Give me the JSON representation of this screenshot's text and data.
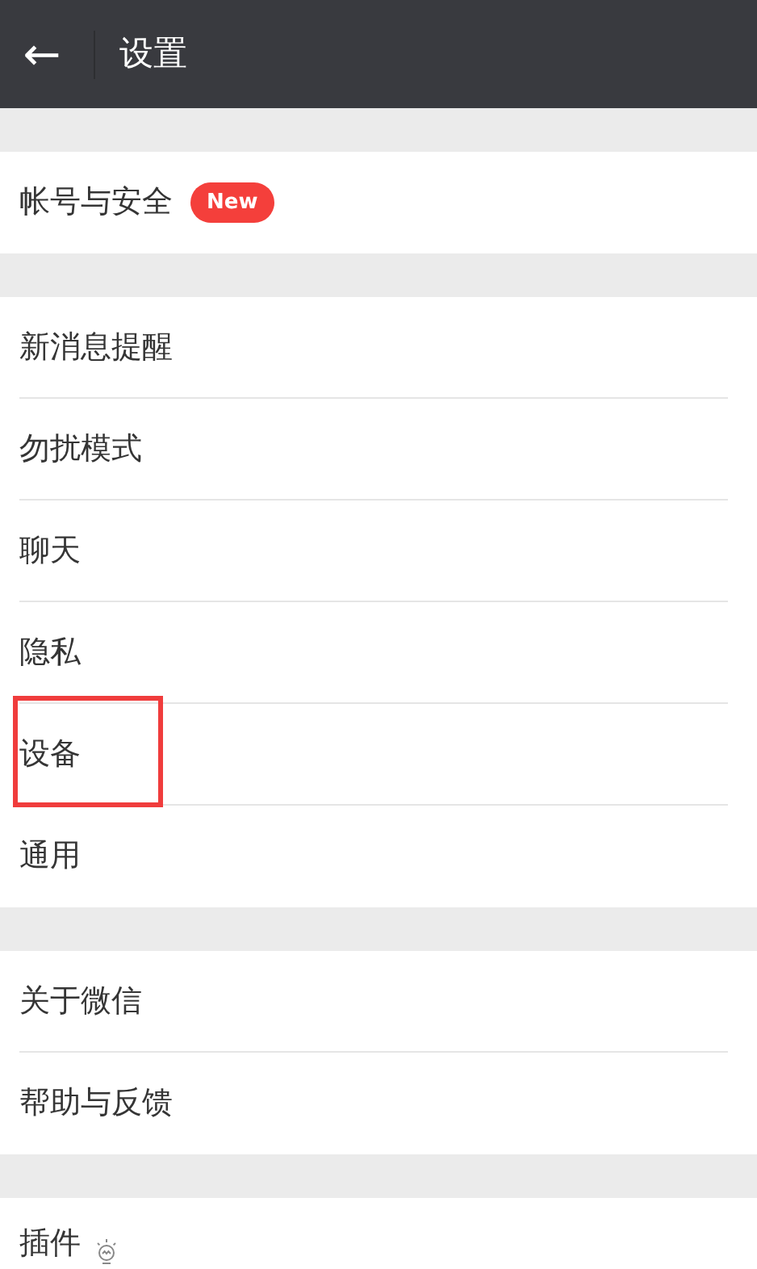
{
  "header": {
    "back": "←",
    "title": "设置"
  },
  "groups": [
    {
      "items": [
        {
          "label": "帐号与安全",
          "badge": "New",
          "highlighted": false
        }
      ]
    },
    {
      "items": [
        {
          "label": "新消息提醒",
          "highlighted": false
        },
        {
          "label": "勿扰模式",
          "highlighted": false
        },
        {
          "label": "聊天",
          "highlighted": false
        },
        {
          "label": "隐私",
          "highlighted": false
        },
        {
          "label": "设备",
          "highlighted": true
        },
        {
          "label": "通用",
          "highlighted": false
        }
      ]
    },
    {
      "items": [
        {
          "label": "关于微信",
          "highlighted": false
        },
        {
          "label": "帮助与反馈",
          "highlighted": false
        }
      ]
    },
    {
      "items": [
        {
          "label": "插件",
          "kind": "bulb",
          "highlighted": false
        }
      ]
    }
  ]
}
